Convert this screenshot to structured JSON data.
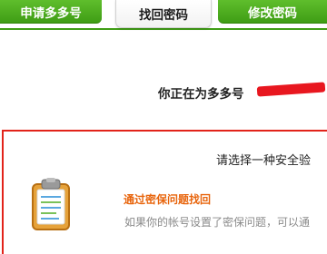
{
  "tabs": {
    "apply_label": "申请多多号",
    "recover_label": "找回密码",
    "modify_label": "修改密码"
  },
  "notice": {
    "text": "你正在为多多号"
  },
  "security": {
    "prompt": "请选择一种安全验",
    "method_title": "通过密保问题找回",
    "method_desc": "如果你的帐号设置了密保问题，可以通"
  },
  "icons": {
    "method_icon": "clipboard-icon"
  },
  "colors": {
    "tab_green": "#3f9d15",
    "border_red": "#e2231a",
    "method_title_orange": "#e8650d",
    "redaction_red": "#e8171f"
  }
}
